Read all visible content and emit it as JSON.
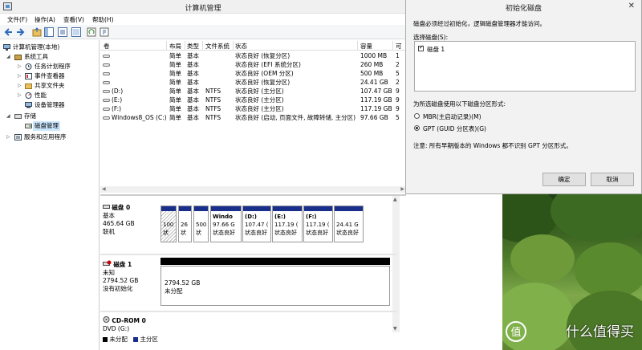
{
  "window": {
    "title": "计算机管理"
  },
  "menu": [
    "文件(F)",
    "操作(A)",
    "查看(V)",
    "帮助(H)"
  ],
  "tree": {
    "root": "计算机管理(本地)",
    "system_tools": "系统工具",
    "task_scheduler": "任务计划程序",
    "event_viewer": "事件查看器",
    "shared_folders": "共享文件夹",
    "performance": "性能",
    "device_manager": "设备管理器",
    "storage": "存储",
    "disk_management": "磁盘管理",
    "services_apps": "服务和应用程序"
  },
  "volumes": {
    "headers": [
      "卷",
      "布局",
      "类型",
      "文件系统",
      "状态",
      "容量",
      "可"
    ],
    "rows": [
      {
        "vol": "",
        "layout": "简单",
        "type": "基本",
        "fs": "",
        "status": "状态良好 (恢复分区)",
        "cap": "1000 MB",
        "free": "1"
      },
      {
        "vol": "",
        "layout": "简单",
        "type": "基本",
        "fs": "",
        "status": "状态良好 (EFI 系统分区)",
        "cap": "260 MB",
        "free": "2"
      },
      {
        "vol": "",
        "layout": "简单",
        "type": "基本",
        "fs": "",
        "status": "状态良好 (OEM 分区)",
        "cap": "500 MB",
        "free": "5"
      },
      {
        "vol": "",
        "layout": "简单",
        "type": "基本",
        "fs": "",
        "status": "状态良好 (恢复分区)",
        "cap": "24.41 GB",
        "free": "2"
      },
      {
        "vol": "(D:)",
        "layout": "简单",
        "type": "基本",
        "fs": "NTFS",
        "status": "状态良好 (主分区)",
        "cap": "107.47 GB",
        "free": "9"
      },
      {
        "vol": "(E:)",
        "layout": "简单",
        "type": "基本",
        "fs": "NTFS",
        "status": "状态良好 (主分区)",
        "cap": "117.19 GB",
        "free": "9"
      },
      {
        "vol": "(F:)",
        "layout": "简单",
        "type": "基本",
        "fs": "NTFS",
        "status": "状态良好 (主分区)",
        "cap": "117.19 GB",
        "free": "9"
      },
      {
        "vol": "Windows8_OS (C:)",
        "layout": "简单",
        "type": "基本",
        "fs": "NTFS",
        "status": "状态良好 (启动, 页面文件, 故障转储, 主分区)",
        "cap": "97.66 GB",
        "free": "5"
      }
    ]
  },
  "disks": {
    "disk0": {
      "name": "磁盘 0",
      "type": "基本",
      "size": "465.64 GB",
      "state": "联机"
    },
    "disk0_parts": [
      {
        "l1": "",
        "l2": "100",
        "l3": "状"
      },
      {
        "l1": "",
        "l2": "26",
        "l3": "状"
      },
      {
        "l1": "",
        "l2": "500",
        "l3": "状"
      },
      {
        "l1": "Windo",
        "l2": "97.66 G",
        "l3": "状态良好"
      },
      {
        "l1": "(D:)",
        "l2": "107.47 (",
        "l3": "状态良好"
      },
      {
        "l1": "(E:)",
        "l2": "117.19 (",
        "l3": "状态良好"
      },
      {
        "l1": "(F:)",
        "l2": "117.19 (",
        "l3": "状态良好"
      },
      {
        "l1": "",
        "l2": "24.41 G",
        "l3": "状态良好"
      }
    ],
    "disk1": {
      "name": "磁盘 1",
      "type": "未知",
      "size": "2794.52 GB",
      "state": "没有初始化"
    },
    "disk1_part": {
      "size": "2794.52 GB",
      "status": "未分配"
    },
    "cdrom": {
      "name": "CD-ROM 0",
      "type": "DVD (G:)"
    },
    "legend": [
      "未分配",
      "主分区"
    ],
    "legend_colors": {
      "unallocated": "#000000",
      "primary": "#1a2f8c"
    }
  },
  "dialog": {
    "title": "初始化磁盘",
    "intro": "磁盘必须经过初始化，逻辑磁盘管理器才能访问。",
    "select_label": "选择磁盘(S):",
    "disk_item": "磁盘 1",
    "style_label": "为所选磁盘使用以下磁盘分区形式:",
    "mbr": "MBR(主启动记录)(M)",
    "gpt": "GPT (GUID 分区表)(G)",
    "note": "注意: 所有早期版本的 Windows 都不识别 GPT 分区形式。",
    "ok": "确定",
    "cancel": "取消"
  },
  "watermark": {
    "text": "什么值得买",
    "badge": "值"
  }
}
